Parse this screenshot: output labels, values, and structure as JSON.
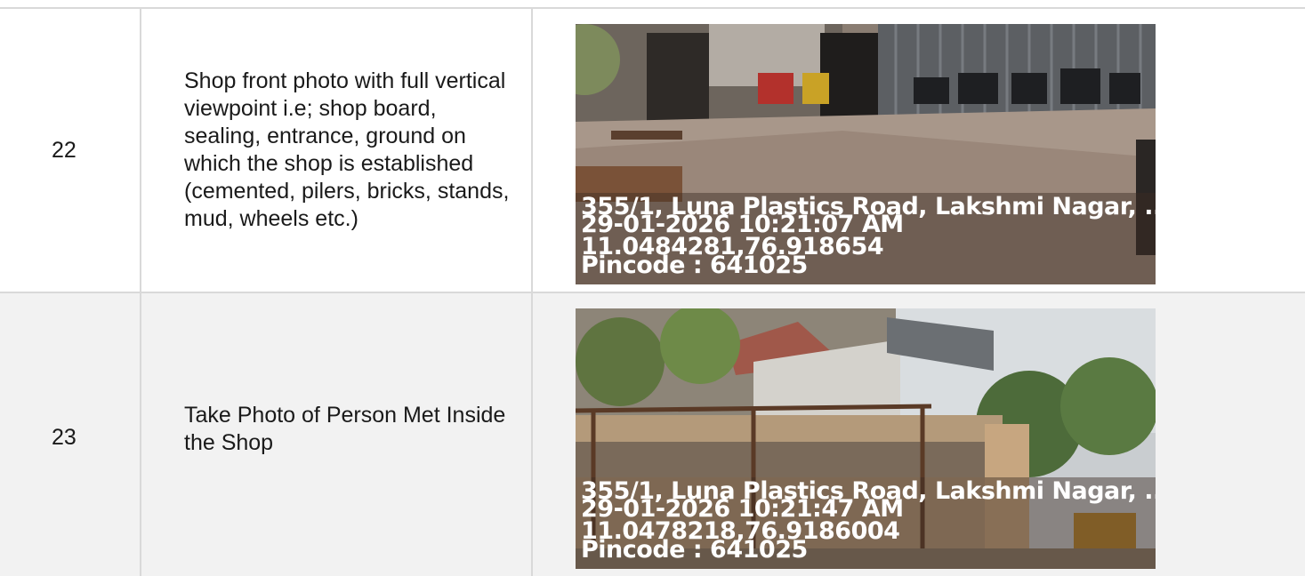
{
  "rows": [
    {
      "number": "22",
      "description": "Shop front photo with full vertical viewpoint i.e; shop board, sealing, entrance, ground on which the shop is established (cemented, pilers, bricks, stands, mud, wheels etc.)",
      "photo": {
        "address": "355/1, Luna Plastics Road, Lakshmi Nagar, ..",
        "timestamp": "29-01-2026 10:21:07 AM",
        "coordinates": "11.0484281,76.918654",
        "pincode": "Pincode : 641025"
      }
    },
    {
      "number": "23",
      "description": "Take Photo of Person Met Inside the Shop",
      "photo": {
        "address": "355/1, Luna Plastics Road, Lakshmi Nagar, ..",
        "timestamp": "29-01-2026 10:21:47 AM",
        "coordinates": "11.0478218,76.9186004",
        "pincode": "Pincode : 641025"
      }
    }
  ]
}
